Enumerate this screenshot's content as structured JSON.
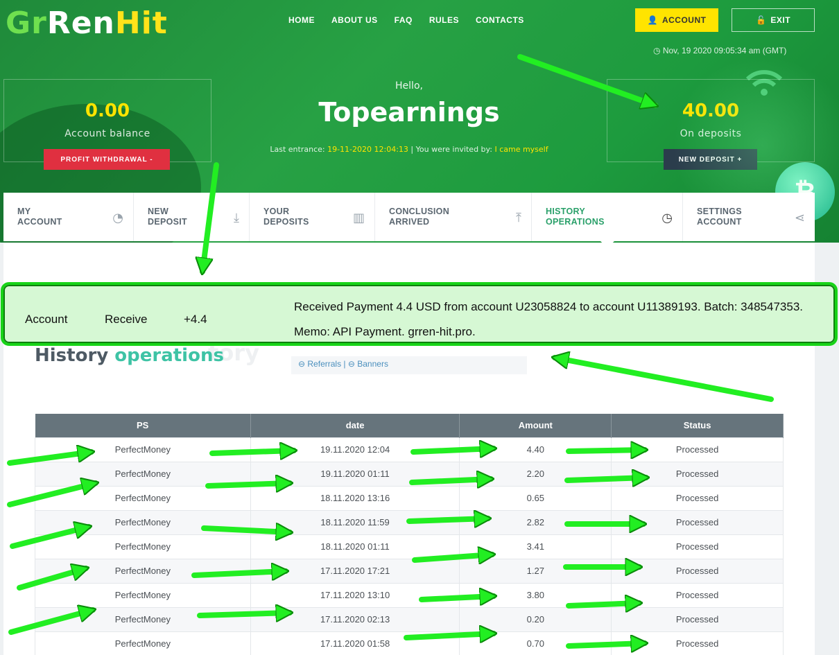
{
  "brand": {
    "part1": "Gr",
    "part2": "Ren",
    "part3": "Hit"
  },
  "nav": [
    "HOME",
    "ABOUT US",
    "FAQ",
    "RULES",
    "CONTACTS"
  ],
  "header_buttons": {
    "account": "ACCOUNT",
    "exit": "EXIT"
  },
  "clock": "Nov, 19 2020 09:05:34 am (GMT)",
  "balance": {
    "amount": "0.00",
    "caption": "Account balance",
    "button": "PROFIT WITHDRAWAL -"
  },
  "deposits": {
    "amount": "40.00",
    "caption": "On deposits",
    "button": "NEW DEPOSIT +"
  },
  "greeting": {
    "hello": "Hello,",
    "username": "Topearnings"
  },
  "last_info": {
    "prefix": "Last entrance:",
    "entrance": "19-11-2020 12:04:13",
    "mid": "| You were invited by:",
    "inviter": "I came myself"
  },
  "tabs": [
    {
      "line1": "MY",
      "line2": "ACCOUNT",
      "icon": "speedometer-icon",
      "glyph": "◔"
    },
    {
      "line1": "NEW",
      "line2": "DEPOSIT",
      "icon": "download-icon",
      "glyph": "⤓"
    },
    {
      "line1": "YOUR",
      "line2": "DEPOSITS",
      "icon": "bar-chart-icon",
      "glyph": "▥"
    },
    {
      "line1": "CONCLUSION",
      "line2": "ARRIVED",
      "icon": "upload-icon",
      "glyph": "⤒"
    },
    {
      "line1": "HISTORY",
      "line2": "OPERATIONS",
      "icon": "history-icon",
      "glyph": "◷"
    },
    {
      "line1": "SETTINGS",
      "line2": "ACCOUNT",
      "icon": "share-icon",
      "glyph": "⋖"
    }
  ],
  "highlight": {
    "col1": "Account",
    "col2": "Receive",
    "col3": "+4.4",
    "line1": "Received Payment 4.4 USD from account U23058824 to account U11389193. Batch: 348547353.",
    "line2": "Memo: API Payment. grren-hit.pro."
  },
  "history": {
    "title_a": "History",
    "title_b": "operations",
    "ghost": "tory",
    "links": "⊖ Referrals | ⊖ Banners"
  },
  "table": {
    "headers": [
      "PS",
      "date",
      "Amount",
      "Status"
    ],
    "rows": [
      [
        "PerfectMoney",
        "19.11.2020 12:04",
        "4.40",
        "Processed"
      ],
      [
        "PerfectMoney",
        "19.11.2020 01:11",
        "2.20",
        "Processed"
      ],
      [
        "PerfectMoney",
        "18.11.2020 13:16",
        "0.65",
        "Processed"
      ],
      [
        "PerfectMoney",
        "18.11.2020 11:59",
        "2.82",
        "Processed"
      ],
      [
        "PerfectMoney",
        "18.11.2020 01:11",
        "3.41",
        "Processed"
      ],
      [
        "PerfectMoney",
        "17.11.2020 17:21",
        "1.27",
        "Processed"
      ],
      [
        "PerfectMoney",
        "17.11.2020 13:10",
        "3.80",
        "Processed"
      ],
      [
        "PerfectMoney",
        "17.11.2020 02:13",
        "0.20",
        "Processed"
      ],
      [
        "PerfectMoney",
        "17.11.2020 01:58",
        "0.70",
        "Processed"
      ]
    ]
  },
  "colors": {
    "header_green": "#27a144",
    "accent_yellow": "#ffe400",
    "highlight_green": "#18d418",
    "table_header": "#66747c"
  }
}
